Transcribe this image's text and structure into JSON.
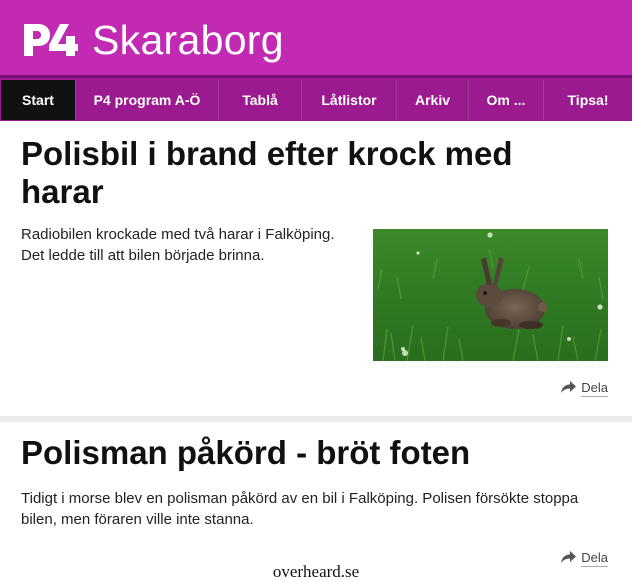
{
  "header": {
    "logo_mark": "P4",
    "channel": "Skaraborg",
    "bg_color": "#c22ab4"
  },
  "nav": {
    "bg_color": "#9c1a90",
    "items": [
      {
        "label": "Start",
        "active": true
      },
      {
        "label": "P4 program A-Ö",
        "active": false
      },
      {
        "label": "Tablå",
        "active": false
      },
      {
        "label": "Låtlistor",
        "active": false
      },
      {
        "label": "Arkiv",
        "active": false
      },
      {
        "label": "Om ...",
        "active": false
      },
      {
        "label": "Tipsa!",
        "active": false
      }
    ]
  },
  "articles": [
    {
      "headline": "Polisbil i brand efter krock med harar",
      "lead": "Radiobilen krockade med två harar i Falköping. Det ledde till att bilen började brinna.",
      "share_label": "Dela",
      "share_icon": "share-arrow-icon"
    },
    {
      "headline": "Polisman påkörd - bröt foten",
      "lead": "Tidigt i morse blev en polisman påkörd av en bil i Falköping. Polisen försökte stoppa bilen, men föraren ville inte stanna.",
      "share_label": "Dela",
      "share_icon": "share-arrow-icon"
    }
  ],
  "watermark": "overheard.se"
}
